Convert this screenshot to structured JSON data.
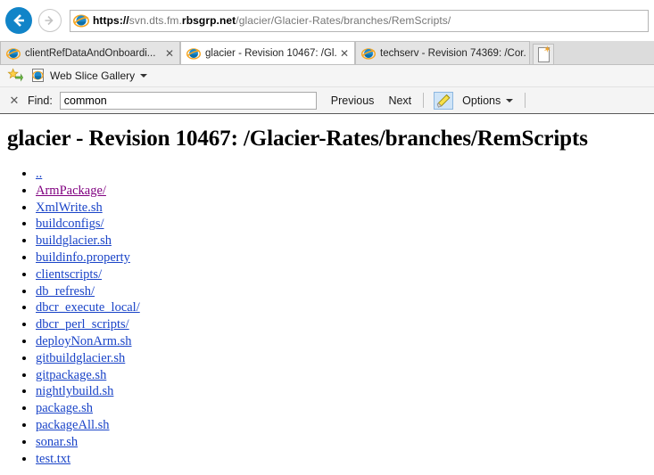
{
  "browser": {
    "back_icon": "back-arrow-icon",
    "forward_icon": "forward-arrow-icon",
    "address": {
      "scheme": "https://",
      "subdomain": "svn.dts.fm.",
      "domain": "rbsgrp.net",
      "path": "/glacier/Glacier-Rates/branches/RemScripts/",
      "full": "https://svn.dts.fm.rbsgrp.net/glacier/Glacier-Rates/branches/RemScripts/",
      "favicon": "ie-logo-icon"
    },
    "tabs": [
      {
        "title": "clientRefDataAndOnboardi...",
        "active": false,
        "close_label": "✕"
      },
      {
        "title": "glacier - Revision 10467: /Gl...",
        "active": true,
        "close_label": "✕"
      },
      {
        "title": "techserv - Revision 74369: /Cor...",
        "active": false,
        "close_label": ""
      }
    ],
    "new_tab_label": "",
    "favorites_bar": {
      "add_favorite_icon": "add-favorite-star-icon",
      "items": [
        {
          "label": "Web Slice Gallery",
          "icon": "web-slice-icon",
          "has_caret": true
        }
      ]
    },
    "find_bar": {
      "close_label": "✕",
      "label": "Find:",
      "value": "common",
      "placeholder": "",
      "previous_label": "Previous",
      "next_label": "Next",
      "highlight_icon": "highlighter-pen-icon",
      "options_label": "Options"
    }
  },
  "page": {
    "title": "glacier - Revision 10467: /Glacier-Rates/branches/RemScripts",
    "entries": [
      {
        "label": "..",
        "visited": false
      },
      {
        "label": "ArmPackage/",
        "visited": true
      },
      {
        "label": "XmlWrite.sh",
        "visited": false
      },
      {
        "label": "buildconfigs/",
        "visited": false
      },
      {
        "label": "buildglacier.sh",
        "visited": false
      },
      {
        "label": "buildinfo.property",
        "visited": false
      },
      {
        "label": "clientscripts/",
        "visited": false
      },
      {
        "label": "db_refresh/",
        "visited": false
      },
      {
        "label": "dbcr_execute_local/",
        "visited": false
      },
      {
        "label": "dbcr_perl_scripts/",
        "visited": false
      },
      {
        "label": "deployNonArm.sh",
        "visited": false
      },
      {
        "label": "gitbuildglacier.sh",
        "visited": false
      },
      {
        "label": "gitpackage.sh",
        "visited": false
      },
      {
        "label": "nightlybuild.sh",
        "visited": false
      },
      {
        "label": "package.sh",
        "visited": false
      },
      {
        "label": "packageAll.sh",
        "visited": false
      },
      {
        "label": "sonar.sh",
        "visited": false
      },
      {
        "label": "test.txt",
        "visited": false
      }
    ]
  },
  "colors": {
    "link": "#1a44c8",
    "visited_link": "#800080",
    "back_button": "#1184c8",
    "toolbar_bg": "#f4f4f4",
    "tabbar_bg": "#dcdcdc"
  }
}
